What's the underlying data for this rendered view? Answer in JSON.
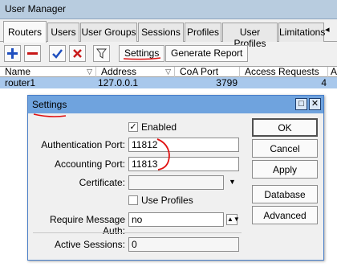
{
  "window": {
    "title": "User Manager"
  },
  "tabs": [
    {
      "label": "Routers",
      "active": true
    },
    {
      "label": "Users"
    },
    {
      "label": "User Groups"
    },
    {
      "label": "Sessions"
    },
    {
      "label": "Profiles"
    },
    {
      "label": "User Profiles"
    },
    {
      "label": "Limitations"
    }
  ],
  "toolbar": {
    "settings_label": "Settings",
    "report_label": "Generate Report",
    "icons": [
      "plus-icon",
      "minus-icon",
      "check-icon",
      "cross-icon",
      "filter-icon"
    ]
  },
  "table": {
    "columns": [
      "Name",
      "Address",
      "CoA Port",
      "Access Requests",
      "A"
    ],
    "rows": [
      {
        "name": "router1",
        "address": "127.0.0.1",
        "coa_port": "3799",
        "access_requests": "4"
      }
    ]
  },
  "dialog": {
    "title": "Settings",
    "enabled_label": "Enabled",
    "enabled_checked": true,
    "auth_port_label": "Authentication Port:",
    "auth_port_value": "11812",
    "acct_port_label": "Accounting Port:",
    "acct_port_value": "11813",
    "certificate_label": "Certificate:",
    "certificate_value": "",
    "use_profiles_label": "Use Profiles",
    "use_profiles_checked": false,
    "require_msg_auth_label": "Require Message Auth:",
    "require_msg_auth_value": "no",
    "active_sessions_label": "Active Sessions:",
    "active_sessions_value": "0",
    "buttons": {
      "ok": "OK",
      "cancel": "Cancel",
      "apply": "Apply",
      "database": "Database",
      "advanced": "Advanced"
    }
  },
  "colors": {
    "title_bar": "#b8ccdf",
    "dialog_title": "#6fa3de",
    "selected_row": "#a8c8ec",
    "annotation_red": "#e01010"
  }
}
